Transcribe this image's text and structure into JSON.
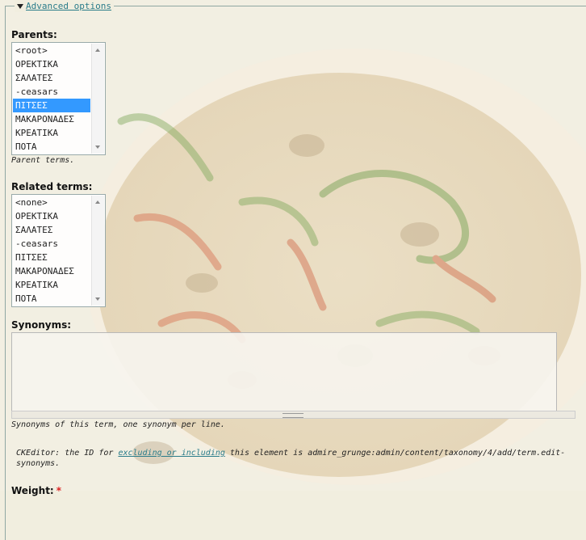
{
  "fieldset": {
    "legend": "Advanced options"
  },
  "parents": {
    "label": "Parents:",
    "options": [
      "<root>",
      "ΟΡΕΚΤΙΚΑ",
      "ΣΑΛΑΤΕΣ",
      "-ceasars",
      "ΠΙΤΣΕΣ",
      "ΜΑΚΑΡΟΝΑΔΕΣ",
      "ΚΡΕΑΤΙΚΑ",
      "ΠΟΤΑ"
    ],
    "selected": "ΠΙΤΣΕΣ",
    "description": "Parent terms."
  },
  "related": {
    "label": "Related terms:",
    "options": [
      "<none>",
      "ΟΡΕΚΤΙΚΑ",
      "ΣΑΛΑΤΕΣ",
      "-ceasars",
      "ΠΙΤΣΕΣ",
      "ΜΑΚΑΡΟΝΑΔΕΣ",
      "ΚΡΕΑΤΙΚΑ",
      "ΠΟΤΑ"
    ],
    "selected": null
  },
  "synonyms": {
    "label": "Synonyms:",
    "value": "",
    "description": "Synonyms of this term, one synonym per line."
  },
  "ckeditor_note": {
    "prefix": "CKEditor: the ID for ",
    "link_text": "excluding or including",
    "suffix": " this element is admire_grunge:admin/content/taxonomy/4/add/term.edit-synonyms."
  },
  "weight": {
    "label": "Weight:",
    "required_marker": "*"
  },
  "colors": {
    "link": "#2a7c8a",
    "selection": "#3399ff",
    "required": "#dd2222",
    "background": "#f1eedf"
  }
}
